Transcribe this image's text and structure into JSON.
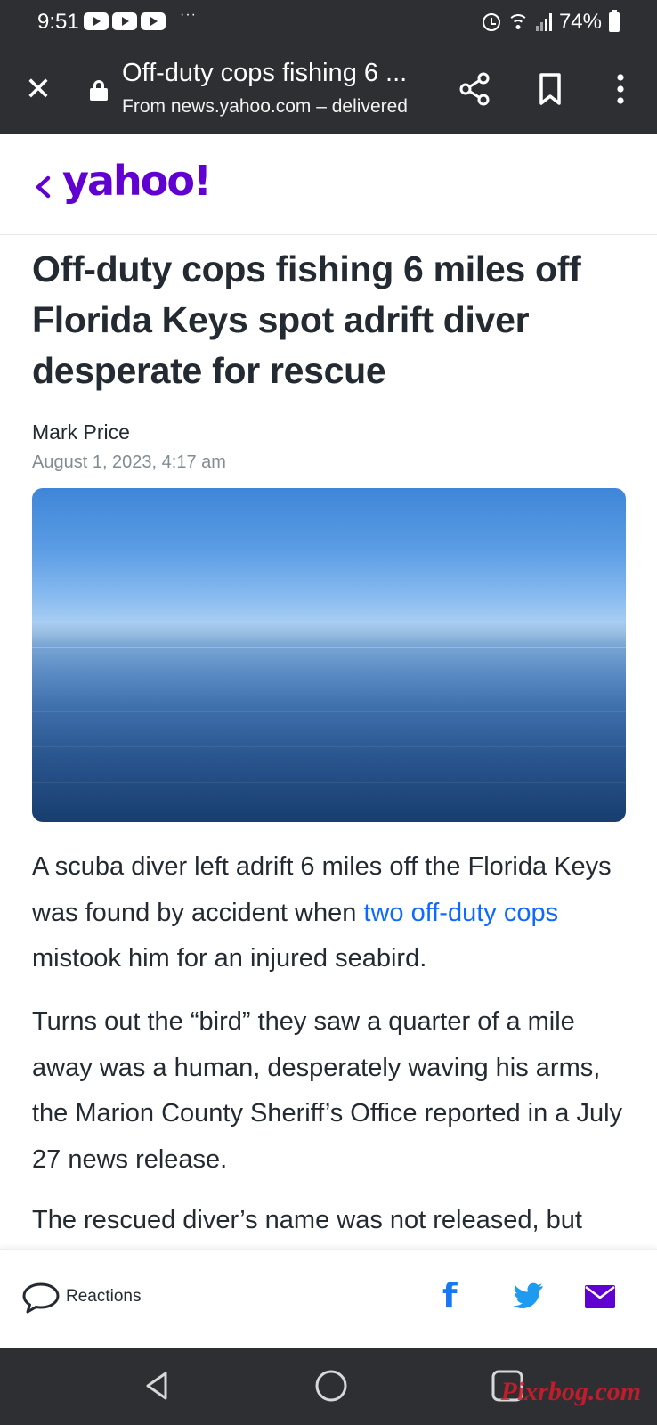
{
  "status_bar": {
    "time": "9:51",
    "overflow": "···",
    "battery": "74%",
    "icons": [
      "youtube-icon",
      "youtube-icon",
      "youtube-icon",
      "alarm-icon",
      "wifi-icon",
      "signal-icon",
      "battery-icon"
    ]
  },
  "toolbar": {
    "title": "Off-duty cops fishing 6 ...",
    "url": "From news.yahoo.com – delivered",
    "icons": [
      "close-icon",
      "lock-icon",
      "share-icon",
      "bookmark-icon",
      "more-vert-icon"
    ]
  },
  "header": {
    "logo": "yahoo!",
    "logo_color": "#6001d2"
  },
  "article": {
    "headline": "Off-duty cops fishing 6 miles off Florida Keys spot adrift diver desperate for rescue",
    "author": "Mark Price",
    "date": "August 1, 2023, 4:17 am",
    "p1_before": "A scuba diver left adrift 6 miles off the Florida Keys was found by accident when ",
    "p1_link": "two off-duty cops",
    "p1_after": " mistook him for an injured seabird.",
    "p2": "Turns out the “bird” they saw a quarter of a mile away was a human, desperately waving his arms, the Marion County Sheriff’s Office reported in a July 27 news release.",
    "p3": "The rescued diver’s name was not released, but",
    "link_color": "#0f69ff"
  },
  "share_bar": {
    "reactions_label": "Reactions",
    "icons": [
      "comment-icon",
      "facebook-icon",
      "twitter-icon",
      "mail-icon"
    ],
    "facebook_color": "#1877f2",
    "twitter_color": "#1d9bf0",
    "mail_color": "#6001d2"
  },
  "nav_bar": {
    "icons": [
      "back-icon",
      "home-icon",
      "recents-icon"
    ]
  },
  "watermark": "Pixrbog.com"
}
